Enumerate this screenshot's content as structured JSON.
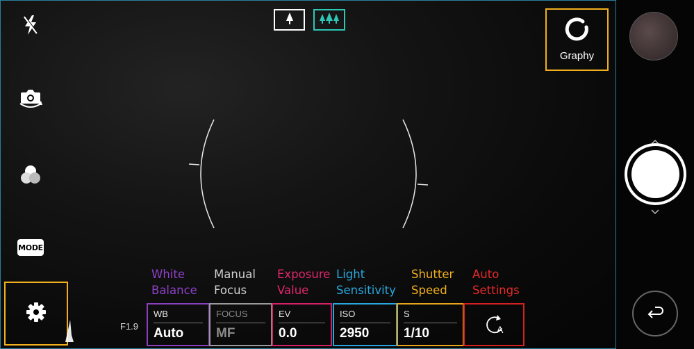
{
  "top_toggles": {
    "single_icon": "tree-single-icon",
    "multi_icon": "tree-multi-icon"
  },
  "left_controls": {
    "flash_icon": "flash-off-icon",
    "switch_icon": "switch-camera-icon",
    "filter_icon": "filter-icon",
    "mode_label": "MODE",
    "settings_icon": "gear-icon"
  },
  "graphy": {
    "label": "Graphy",
    "icon": "graphy-ring-icon"
  },
  "aperture": {
    "label": "F1.9"
  },
  "annotations": [
    {
      "line1": "White",
      "line2": "Balance",
      "color": "#8f41c8"
    },
    {
      "line1": "Manual",
      "line2": "Focus",
      "color": "#d0d0d0"
    },
    {
      "line1": "Exposure",
      "line2": "Value",
      "color": "#e0266d"
    },
    {
      "line1": "Light",
      "line2": "Sensitivity",
      "color": "#29a8de"
    },
    {
      "line1": "Shutter",
      "line2": "Speed",
      "color": "#f2b01e"
    },
    {
      "line1": "Auto",
      "line2": "Settings",
      "color": "#e82a2a"
    }
  ],
  "params": [
    {
      "label": "WB",
      "value": "Auto",
      "border": "#8a3fbd"
    },
    {
      "label": "FOCUS",
      "value": "MF",
      "border": "#9a9a9a"
    },
    {
      "label": "EV",
      "value": "0.0",
      "border": "#d42268"
    },
    {
      "label": "ISO",
      "value": "2950",
      "border": "#2aa6dd"
    },
    {
      "label": "S",
      "value": "1/10",
      "border": "#e7a51c"
    }
  ],
  "auto_settings": {
    "icon": "auto-reset-icon",
    "letter": "A",
    "border": "#d42020"
  },
  "right_panel": {
    "gallery_icon": "gallery-thumbnail",
    "shutter_icon": "shutter-icon",
    "back_icon": "back-arrow-icon"
  }
}
